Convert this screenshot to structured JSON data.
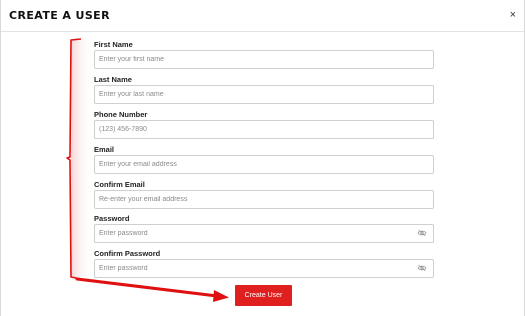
{
  "modal": {
    "title": "CREATE A USER",
    "close_icon": "close-icon",
    "close_glyph": "×"
  },
  "form": {
    "fields": [
      {
        "label": "First Name",
        "placeholder": "Enter your first name"
      },
      {
        "label": "Last Name",
        "placeholder": "Enter your last name"
      },
      {
        "label": "Phone Number",
        "placeholder": "(123) 456-7890"
      },
      {
        "label": "Email",
        "placeholder": "Enter your email address"
      },
      {
        "label": "Confirm Email",
        "placeholder": "Re-enter your email address"
      },
      {
        "label": "Password",
        "placeholder": "Enter password",
        "toggle_icon": "eye-slash-icon"
      },
      {
        "label": "Confirm Password",
        "placeholder": "Enter password",
        "toggle_icon": "eye-slash-icon"
      }
    ],
    "submit_label": "Create User"
  },
  "colors": {
    "accent": "#e0201f",
    "annotation": "#e01010"
  }
}
